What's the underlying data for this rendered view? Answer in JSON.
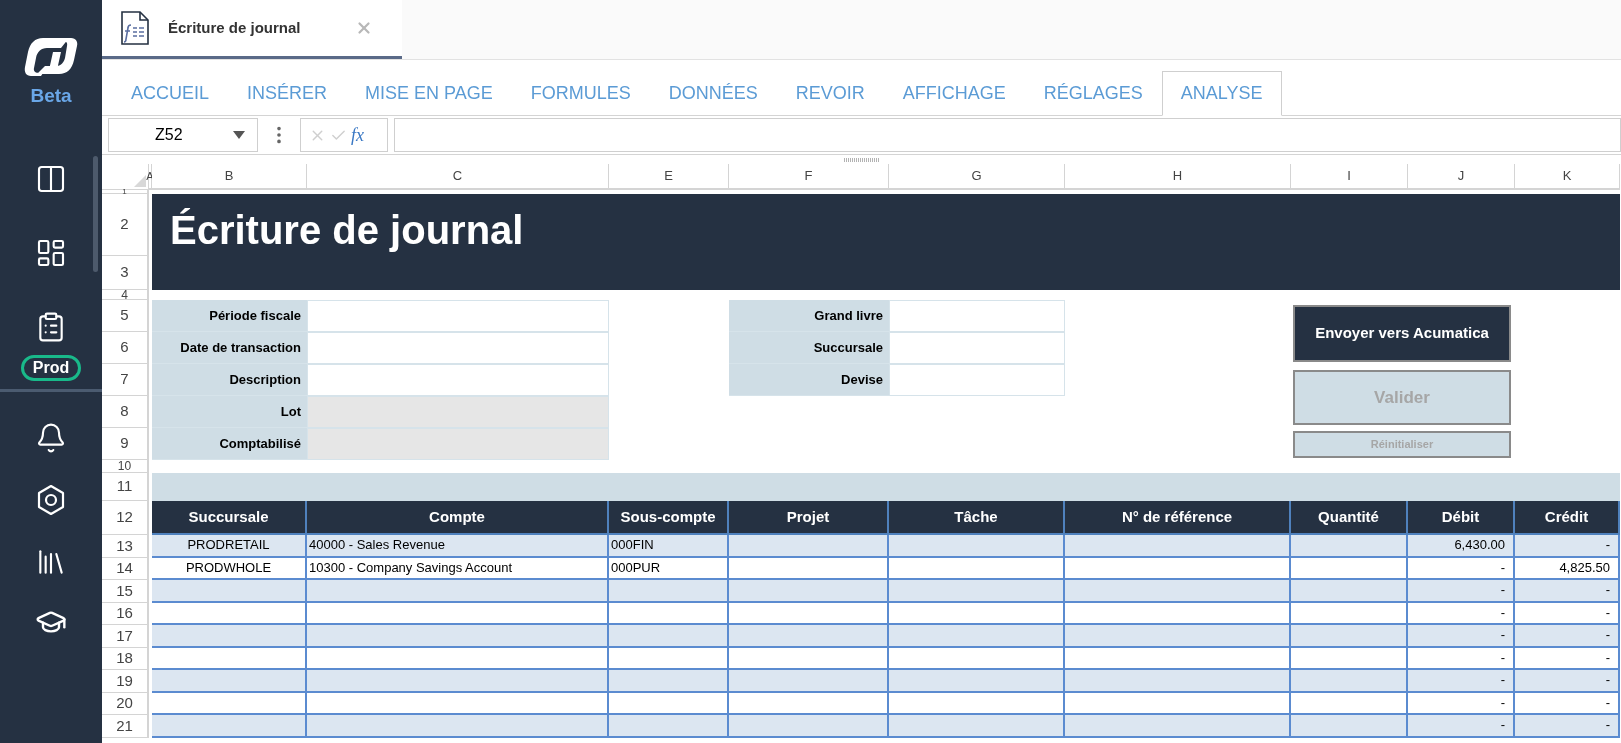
{
  "sidebar": {
    "logo_caption": "Beta",
    "env_badge": "Prod"
  },
  "document_tab": {
    "title": "Écriture de journal",
    "selected": true
  },
  "ribbon_tabs": [
    {
      "label": "ACCUEIL",
      "selected": false
    },
    {
      "label": "INSÉRER",
      "selected": false
    },
    {
      "label": "MISE EN PAGE",
      "selected": false
    },
    {
      "label": "FORMULES",
      "selected": false
    },
    {
      "label": "DONNÉES",
      "selected": false
    },
    {
      "label": "REVOIR",
      "selected": false
    },
    {
      "label": "AFFICHAGE",
      "selected": false
    },
    {
      "label": "RÉGLAGES",
      "selected": false
    },
    {
      "label": "ANALYSE",
      "selected": true
    }
  ],
  "formula_bar": {
    "cell_ref": "Z52",
    "fx": "fx"
  },
  "sheet": {
    "column_letters": [
      "A",
      "B",
      "C",
      "E",
      "F",
      "G",
      "H",
      "I",
      "J",
      "K"
    ],
    "row_numbers": [
      "1",
      "2",
      "3",
      "4",
      "5",
      "6",
      "7",
      "8",
      "9",
      "10",
      "11",
      "12",
      "13",
      "14",
      "15",
      "16",
      "17",
      "18",
      "19",
      "20",
      "21"
    ],
    "title": "Écriture de journal",
    "form_left": [
      {
        "label": "Période fiscale",
        "disabled": false
      },
      {
        "label": "Date de transaction",
        "disabled": false
      },
      {
        "label": "Description",
        "disabled": false
      },
      {
        "label": "Lot",
        "disabled": true
      },
      {
        "label": "Comptabilisé",
        "disabled": true
      }
    ],
    "form_right": [
      {
        "label": "Grand livre",
        "disabled": false
      },
      {
        "label": "Succursale",
        "disabled": false
      },
      {
        "label": "Devise",
        "disabled": false
      }
    ],
    "buttons": [
      {
        "label": "Envoyer vers Acumatica",
        "disabled": false
      },
      {
        "label": "Valider",
        "disabled": true
      },
      {
        "label": "Réinitialiser",
        "disabled": true
      }
    ],
    "table": {
      "columns": [
        "Succursale",
        "Compte",
        "Sous-compte",
        "Projet",
        "Tâche",
        "N° de référence",
        "Quantité",
        "Débit",
        "Crédit"
      ],
      "rows": [
        {
          "succursale": "PRODRETAIL",
          "compte": "40000 - Sales Revenue",
          "sous_compte": "000FIN",
          "debit": "6,430.00",
          "credit": "-"
        },
        {
          "succursale": "PRODWHOLE",
          "compte": "10300 - Company Savings Account",
          "sous_compte": "000PUR",
          "debit": "-",
          "credit": "4,825.50"
        },
        {
          "debit": "-",
          "credit": "-"
        },
        {
          "debit": "-",
          "credit": "-"
        },
        {
          "debit": "-",
          "credit": "-"
        },
        {
          "debit": "-",
          "credit": "-"
        },
        {
          "debit": "-",
          "credit": "-"
        },
        {
          "debit": "-",
          "credit": "-"
        },
        {
          "debit": "-",
          "credit": "-"
        }
      ]
    }
  }
}
